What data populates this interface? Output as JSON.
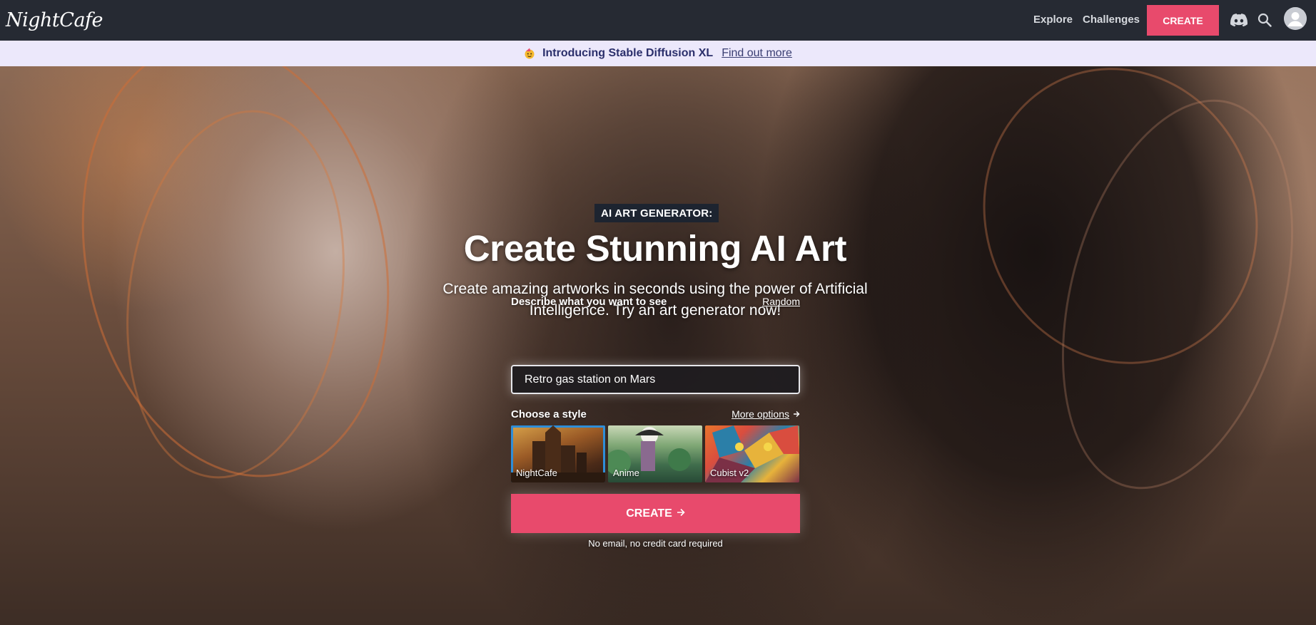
{
  "nav": {
    "logo": "NightCafe",
    "links": [
      "Explore",
      "Challenges"
    ],
    "create_label": "CREATE",
    "icons": [
      "discord-icon",
      "search-icon",
      "avatar-icon"
    ],
    "bg_color": "#262a33",
    "accent": "#e84a6c"
  },
  "banner": {
    "emoji_icon": "party-face-emoji",
    "text": "Introducing Stable Diffusion XL",
    "link": "Find out more",
    "bg_color": "#ece8fb"
  },
  "hero": {
    "eyebrow": "AI ART GENERATOR:",
    "title": "Create Stunning AI Art",
    "subtitle": "Create amazing artworks in seconds using the power of Artificial Intelligence. Try an art generator now!",
    "prompt_label": "Describe what you want to see",
    "random_link": "Random",
    "prompt_value": "Retro gas station on Mars",
    "style_label": "Choose a style",
    "more_options": "More options",
    "styles": [
      {
        "name": "NightCafe",
        "selected": true
      },
      {
        "name": "Anime",
        "selected": false
      },
      {
        "name": "Cubist v2",
        "selected": false
      }
    ],
    "create_label": "CREATE",
    "fineprint": "No email, no credit card required",
    "selected_color": "#2f8ed8"
  }
}
